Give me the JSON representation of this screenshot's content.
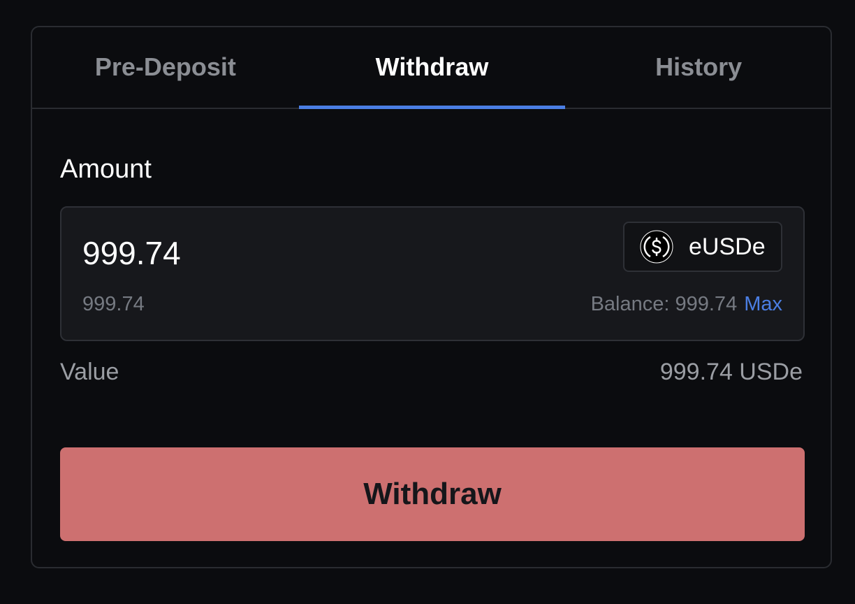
{
  "tabs": [
    {
      "label": "Pre-Deposit",
      "active": false
    },
    {
      "label": "Withdraw",
      "active": true
    },
    {
      "label": "History",
      "active": false
    }
  ],
  "form": {
    "amount_label": "Amount",
    "amount_value": "999.74",
    "usd_value": "999.74",
    "token": {
      "name": "eUSDe",
      "icon": "usd-coin-icon"
    },
    "balance_label": "Balance: 999.74",
    "max_label": "Max",
    "value_label": "Value",
    "value_amount": "999.74 USDe",
    "submit_label": "Withdraw"
  },
  "colors": {
    "background": "#0b0c0f",
    "accent": "#4b7ee3",
    "button": "#cd7070"
  }
}
